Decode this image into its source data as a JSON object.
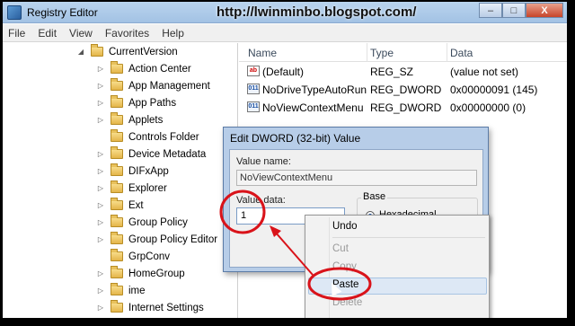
{
  "window": {
    "title": "Registry Editor",
    "watermark": "http://lwinminbo.blogspot.com/",
    "buttons": {
      "minimize": "–",
      "maximize": "□",
      "close": "X"
    }
  },
  "menu": [
    "File",
    "Edit",
    "View",
    "Favorites",
    "Help"
  ],
  "tree": {
    "parent": "CurrentVersion",
    "items": [
      "Action Center",
      "App Management",
      "App Paths",
      "Applets",
      "Controls Folder",
      "Device Metadata",
      "DIFxApp",
      "Explorer",
      "Ext",
      "Group Policy",
      "Group Policy Editor",
      "GrpConv",
      "HomeGroup",
      "ime",
      "Internet Settings"
    ]
  },
  "list": {
    "headers": {
      "name": "Name",
      "type": "Type",
      "data": "Data"
    },
    "rows": [
      {
        "icon": "string-value-icon",
        "name": "(Default)",
        "type": "REG_SZ",
        "data": "(value not set)"
      },
      {
        "icon": "dword-value-icon",
        "name": "NoDriveTypeAutoRun",
        "type": "REG_DWORD",
        "data": "0x00000091 (145)"
      },
      {
        "icon": "dword-value-icon",
        "name": "NoViewContextMenu",
        "type": "REG_DWORD",
        "data": "0x00000000 (0)"
      }
    ]
  },
  "dialog": {
    "title": "Edit DWORD (32-bit) Value",
    "value_name_label": "Value name:",
    "value_name": "NoViewContextMenu",
    "value_data_label": "Value data:",
    "value_data": "1",
    "base_label": "Base",
    "base_selected": "Hexadecimal"
  },
  "context_menu": {
    "items": [
      {
        "label": "Undo",
        "enabled": true
      },
      {
        "label": "Cut",
        "enabled": false
      },
      {
        "label": "Copy",
        "enabled": false
      },
      {
        "label": "Paste",
        "enabled": true,
        "highlighted": true
      },
      {
        "label": "Delete",
        "enabled": false
      }
    ]
  },
  "colors": {
    "annotation": "#d9131a",
    "titlebar": "#b9d4ee",
    "highlight": "#dde8f5"
  }
}
